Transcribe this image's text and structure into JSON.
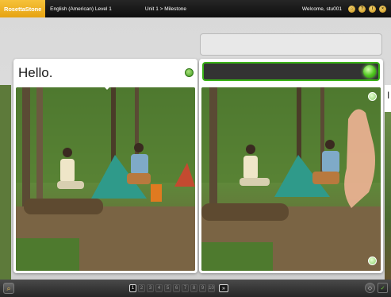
{
  "header": {
    "brand": "RosettaStone",
    "course": "English (American) Level 1",
    "breadcrumb": "Unit 1 > Milestone",
    "welcome": "Welcome, stu001",
    "icons": [
      "home-icon",
      "help-icon",
      "info-icon",
      "close-icon"
    ]
  },
  "cards": {
    "left_text": "Hello.",
    "right_text": "",
    "right_edge_letter": "I"
  },
  "pager": {
    "current": "1",
    "pages": [
      "1",
      "2",
      "3",
      "4",
      "5",
      "6",
      "7",
      "8",
      "9",
      "10"
    ],
    "next_label": "»"
  },
  "colors": {
    "brand": "#f0b429",
    "mic_active": "#4fc61f",
    "bar_dark": "#1a1a1a"
  }
}
